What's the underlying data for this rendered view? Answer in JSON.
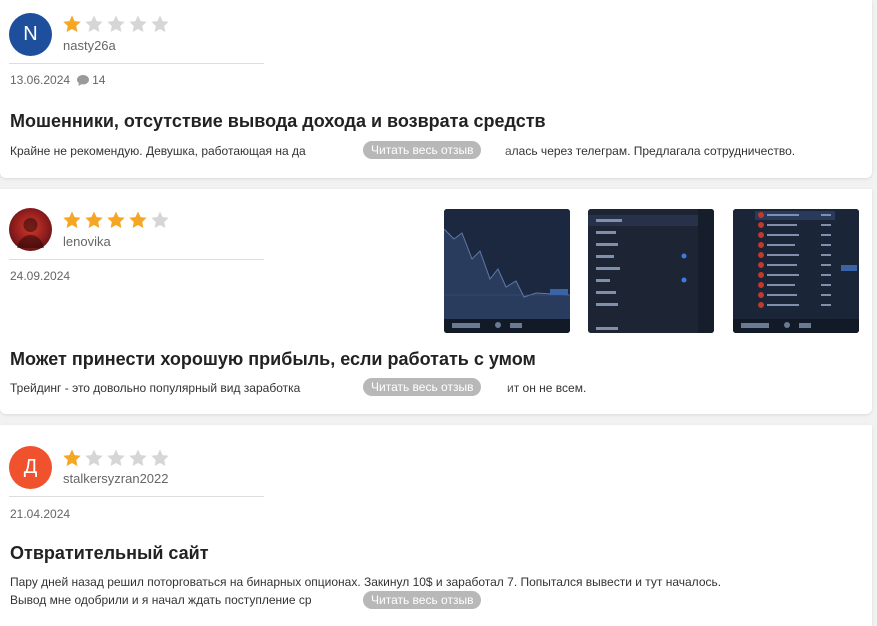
{
  "reviews": [
    {
      "avatar_letter": "N",
      "avatar_color": "#1e4f9c",
      "rating": 1,
      "username": "nasty26a",
      "date": "13.06.2024",
      "comments": "14",
      "title": "Мошенники, отсутствие вывода дохода и возврата средств",
      "text_start": "Крайне не рекомендую. Девушка, работающая на да",
      "text_end": "алась через телеграм. Предлагала сотрудничество.",
      "read_more": "Читать весь отзыв"
    },
    {
      "avatar_letter": "",
      "avatar_color": "#8a1c1c",
      "rating": 4,
      "username": "lenovika",
      "date": "24.09.2024",
      "title": "Может принести хорошую прибыль, если работать с умом",
      "text_start": "Трейдинг - это довольно популярный вид заработка",
      "text_end": "ит он не всем.",
      "read_more": "Читать весь отзыв"
    },
    {
      "avatar_letter": "Д",
      "avatar_color": "#f0522d",
      "rating": 1,
      "username": "stalkersyzran2022",
      "date": "21.04.2024",
      "title": "Отвратительный сайт",
      "text_line1": "Пару дней назад решил поторговаться на бинарных опционах. Закинул 10$ и заработал 7. Попытался вывести и тут началось.",
      "text_start": "Вывод мне одобрили и я начал ждать поступление ср",
      "read_more": "Читать весь отзыв"
    }
  ],
  "colors": {
    "star_filled": "#f5a623",
    "star_empty": "#d6d6d6"
  },
  "icons": {
    "comment": "comment-icon",
    "star": "star-icon"
  }
}
